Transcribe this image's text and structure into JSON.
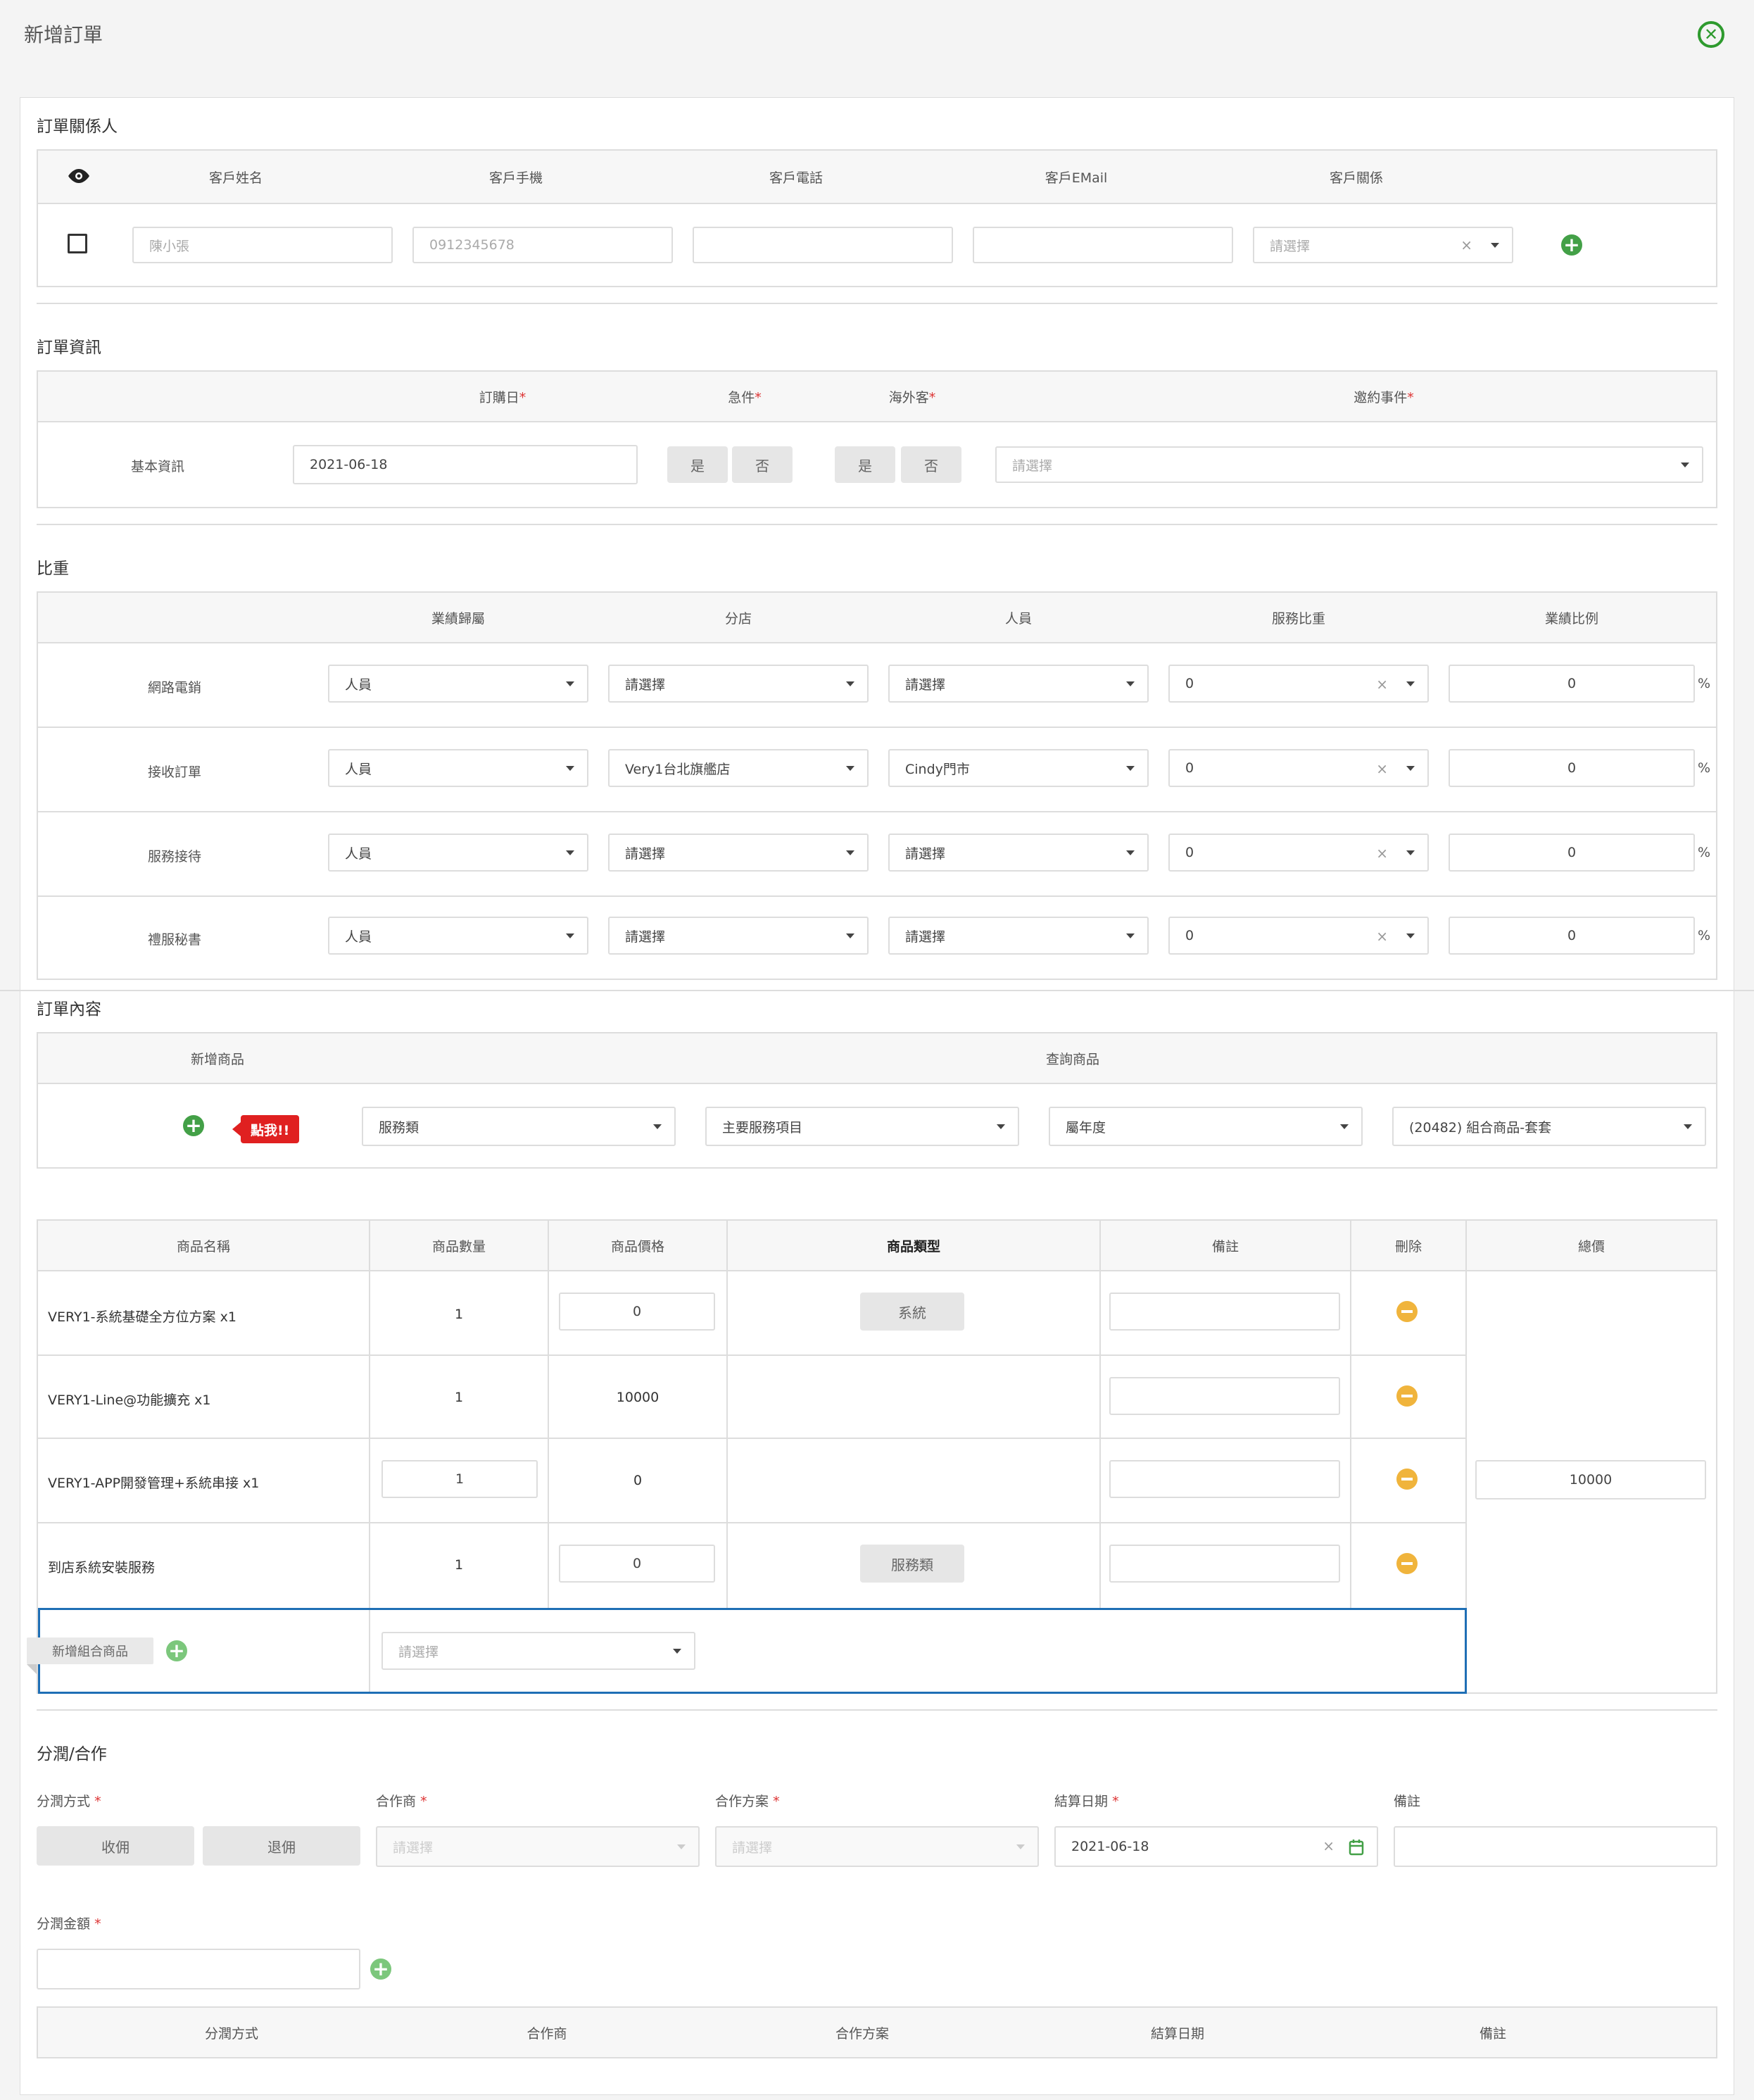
{
  "title": "新增訂單",
  "contact": {
    "section": "訂單關係人",
    "headers": [
      "客戶姓名",
      "客戶手機",
      "客戶電話",
      "客戶EMail",
      "客戶關係"
    ],
    "name": "陳小張",
    "mobile": "0912345678",
    "relation_placeholder": "請選擇"
  },
  "order_info": {
    "section": "訂單資訊",
    "headers": [
      "訂購日",
      "急件",
      "海外客",
      "邀約事件"
    ],
    "row_label": "基本資訊",
    "date": "2021-06-18",
    "yes": "是",
    "no": "否",
    "event_placeholder": "請選擇"
  },
  "weight": {
    "section": "比重",
    "headers": [
      "業績歸屬",
      "分店",
      "人員",
      "服務比重",
      "業績比例"
    ],
    "rows": [
      {
        "label": "網路電銷",
        "owner": "人員",
        "branch": "請選擇",
        "staff": "請選擇",
        "service": "0",
        "ratio": "0"
      },
      {
        "label": "接收訂單",
        "owner": "人員",
        "branch": "Very1台北旗艦店",
        "staff": "Cindy門市",
        "service": "0",
        "ratio": "0"
      },
      {
        "label": "服務接待",
        "owner": "人員",
        "branch": "請選擇",
        "staff": "請選擇",
        "service": "0",
        "ratio": "0"
      },
      {
        "label": "禮服秘書",
        "owner": "人員",
        "branch": "請選擇",
        "staff": "請選擇",
        "service": "0",
        "ratio": "0"
      }
    ],
    "percent": "%"
  },
  "content": {
    "section": "訂單內容",
    "add_product": "新增商品",
    "query_product": "查詢商品",
    "click_me": "點我!!",
    "filters": [
      "服務類",
      "主要服務項目",
      "屬年度",
      "(20482) 組合商品-套套"
    ]
  },
  "products": {
    "headers": [
      "商品名稱",
      "商品數量",
      "商品價格",
      "商品類型",
      "備註",
      "刪除",
      "總價"
    ],
    "rows": [
      {
        "name": "VERY1-系統基礎全方位方案 x1",
        "qty": "1",
        "price": "0",
        "type": "系統"
      },
      {
        "name": "VERY1-Line@功能擴充 x1",
        "qty": "1",
        "price": "10000",
        "type": ""
      },
      {
        "name": "VERY1-APP開發管理+系統串接 x1",
        "qty": "1",
        "price": "0",
        "type": ""
      },
      {
        "name": "到店系統安裝服務",
        "qty": "1",
        "price": "0",
        "type": "服務類"
      }
    ],
    "total": "10000",
    "add_combo": "新增組合商品",
    "combo_placeholder": "請選擇"
  },
  "split": {
    "section": "分潤/合作",
    "method_label": "分潤方式",
    "partner_label": "合作商",
    "plan_label": "合作方案",
    "settle_label": "結算日期",
    "note_label": "備註",
    "btn_collect": "收佣",
    "btn_refund": "退佣",
    "partner_placeholder": "請選擇",
    "plan_placeholder": "請選擇",
    "settle_date": "2021-06-18",
    "amount_label": "分潤金額",
    "table_headers": [
      "分潤方式",
      "合作商",
      "合作方案",
      "結算日期",
      "備註"
    ]
  },
  "colors": {
    "accent": "#43a047",
    "minus": "#f0b43c",
    "badge": "#e02020",
    "highlight": "#1f6fb5"
  }
}
